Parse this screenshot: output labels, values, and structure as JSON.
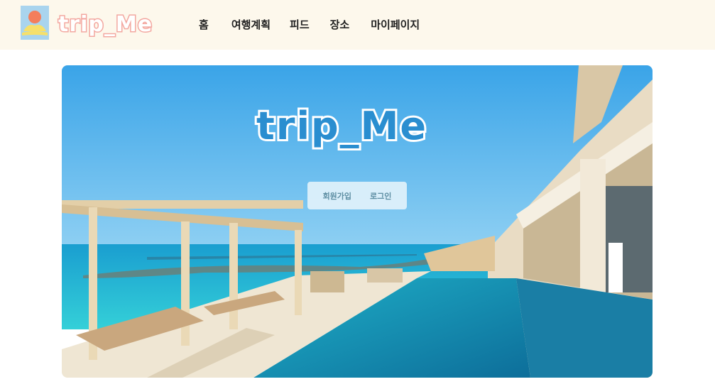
{
  "header": {
    "logo_text": "trip_Me",
    "nav": [
      "홈",
      "여행계획",
      "피드",
      "장소",
      "마이페이지"
    ]
  },
  "hero": {
    "title": "trip_Me",
    "signup_label": "회원가입",
    "login_label": "로그인"
  },
  "colors": {
    "header_bg": "#fdf8ec",
    "logo_pink": "#f3a7a0",
    "sky": "#1e8fd6",
    "sea": "#21b7d3",
    "pool": "#1a8fb4",
    "auth_text": "#5d8ea3"
  },
  "icons": {
    "logo": "sun-over-sand-icon"
  }
}
